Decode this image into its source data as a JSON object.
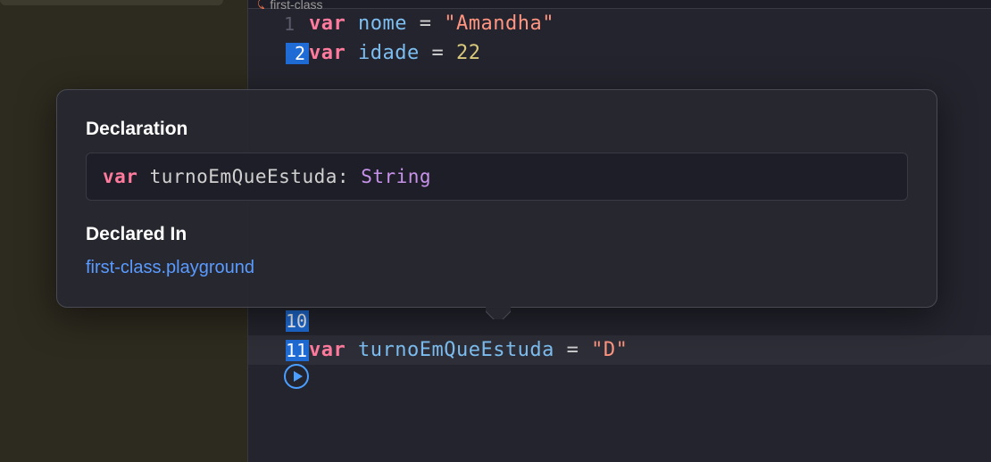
{
  "breadcrumb": {
    "icon": "swift-icon",
    "text": "first-class"
  },
  "editor": {
    "lines": [
      {
        "num": "1",
        "active": false,
        "highlighted": false
      },
      {
        "num": "2",
        "active": true,
        "highlighted": false
      },
      {
        "num": "10",
        "active": true,
        "highlighted": false
      },
      {
        "num": "11",
        "active": true,
        "highlighted": true
      }
    ],
    "line1": {
      "keyword": "var",
      "identifier": "nome",
      "operator": "=",
      "string": "\"Amandha\""
    },
    "line2": {
      "keyword": "var",
      "identifier": "idade",
      "operator": "=",
      "number": "22"
    },
    "line11": {
      "keyword": "var",
      "identifier": "turnoEmQueEstuda",
      "operator": "=",
      "string": "\"D\""
    }
  },
  "popover": {
    "declaration_title": "Declaration",
    "declaration_keyword": "var",
    "declaration_name": "turnoEmQueEstuda",
    "declaration_colon": ": ",
    "declaration_type": "String",
    "declared_in_title": "Declared In",
    "declared_in_link": "first-class.playground"
  }
}
